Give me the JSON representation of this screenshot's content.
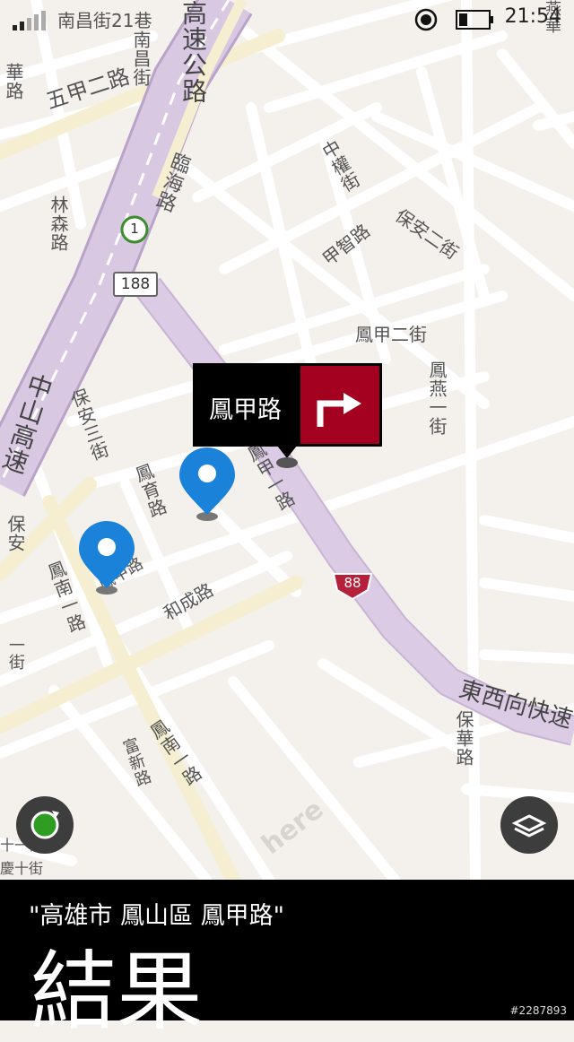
{
  "status": {
    "time": "21:54"
  },
  "map": {
    "road_labels": {
      "nanchang21": "南昌街21巷",
      "nanchang": "南昌街",
      "wujia2": "五甲二路",
      "highway": "高速公路",
      "linhai": "臨海路",
      "linsen": "林森路",
      "ganhua": "華路",
      "zhongshan": "中山高速",
      "zhongquan": "中權街",
      "baoan2": "保安二街",
      "jiazhi": "甲智路",
      "fengjia2": "鳳甲二街",
      "fengyan": "鳳燕一街",
      "baoan3": "保安三街",
      "fengyu": "鳳育路",
      "fengjia1": "鳳甲一路",
      "fengjia_road": "鳳甲路",
      "baoan_left": "保安",
      "fengnan1": "鳳南一路",
      "hecheng": "和成路",
      "fengnan2": "鳳南一路",
      "fuxin": "富新路",
      "dongxi": "東西向快速",
      "baohua": "保華路",
      "yanhua": "燕華",
      "fengqing": "慶十街",
      "left_st": "一街",
      "left_st2": "十一街"
    },
    "shields": {
      "route188": "188",
      "route88": "88",
      "route1": "1"
    },
    "brand": "here"
  },
  "callout": {
    "label": "鳳甲路"
  },
  "bottom": {
    "query": "\"高雄市 鳳山區 鳳甲路\"",
    "result_title": "結果"
  },
  "watermark": "#2287893",
  "colors": {
    "highway": "#d9c8e2",
    "highway_edge": "#b9a3c8",
    "accent_red": "#a4001f",
    "pin_blue": "#1a82d9",
    "gps_green": "#2e9d22"
  },
  "icons": [
    "signal-icon",
    "gps-icon",
    "battery-icon",
    "turn-right-icon",
    "location-pin-icon",
    "compass-icon",
    "layers-icon"
  ]
}
